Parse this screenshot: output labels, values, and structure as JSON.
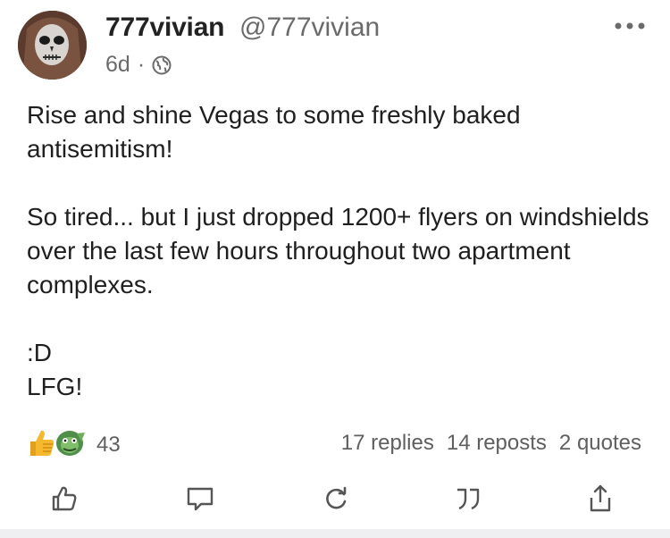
{
  "post": {
    "author_name": "777vivian",
    "author_handle": "@777vivian",
    "time_ago": "6d",
    "separator": "·",
    "visibility_icon": "globe-icon",
    "body": [
      "Rise and shine Vegas to some freshly baked antisemitism!",
      "So tired... but I just dropped 1200+ flyers on windshields over the last few hours throughout two apartment complexes.",
      ":D",
      "LFG!"
    ]
  },
  "stats": {
    "reaction_count": "43",
    "replies": "17 replies",
    "reposts": "14 reposts",
    "quotes": "2 quotes"
  },
  "actions": {
    "like_icon": "thumbs-up-icon",
    "reply_icon": "comment-icon",
    "repost_icon": "repost-icon",
    "quote_icon": "quote-icon",
    "share_icon": "share-icon"
  },
  "colors": {
    "text": "#1f1f1f",
    "muted": "#6a6a6a",
    "icon": "#555555",
    "divider": "#efeff1"
  }
}
